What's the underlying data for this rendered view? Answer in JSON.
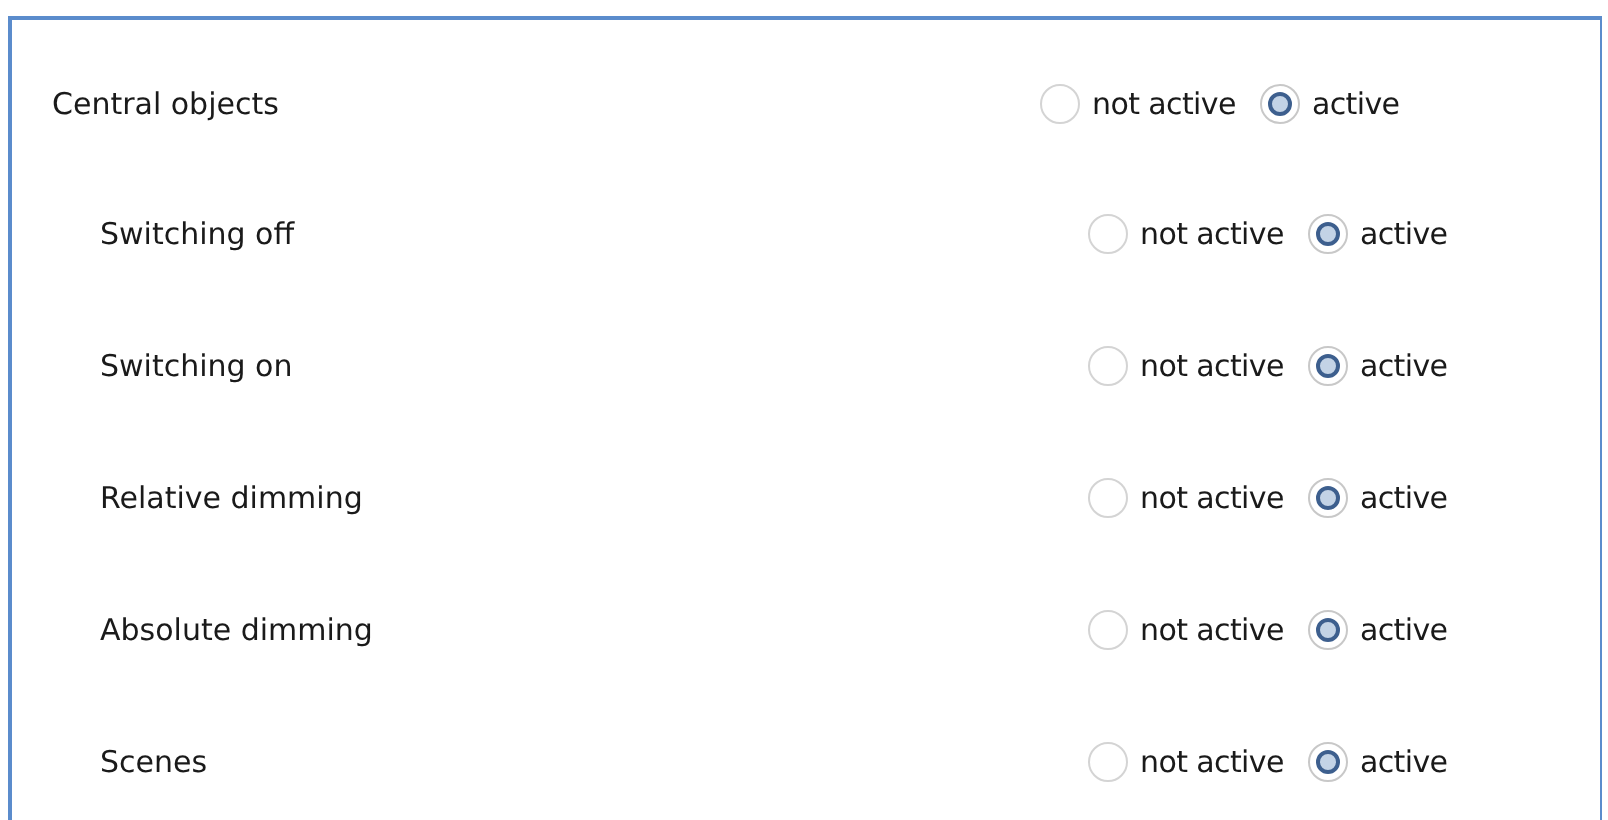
{
  "settings": [
    {
      "label": "Central objects",
      "options": [
        {
          "label": "not active",
          "selected": false
        },
        {
          "label": "active",
          "selected": true
        }
      ],
      "children": [
        {
          "label": "Switching off",
          "options": [
            {
              "label": "not active",
              "selected": false
            },
            {
              "label": "active",
              "selected": true
            }
          ]
        },
        {
          "label": "Switching on",
          "options": [
            {
              "label": "not active",
              "selected": false
            },
            {
              "label": "active",
              "selected": true
            }
          ]
        },
        {
          "label": "Relative dimming",
          "options": [
            {
              "label": "not active",
              "selected": false
            },
            {
              "label": "active",
              "selected": true
            }
          ]
        },
        {
          "label": "Absolute dimming",
          "options": [
            {
              "label": "not active",
              "selected": false
            },
            {
              "label": "active",
              "selected": true
            }
          ]
        },
        {
          "label": "Scenes",
          "options": [
            {
              "label": "not active",
              "selected": false
            },
            {
              "label": "active",
              "selected": true
            }
          ]
        }
      ]
    }
  ]
}
